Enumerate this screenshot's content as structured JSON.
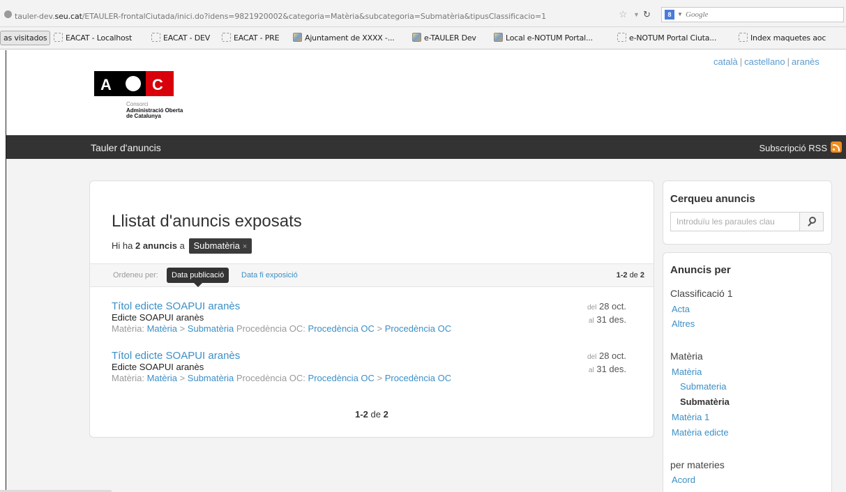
{
  "browser": {
    "url_prefix": "tauler-dev.",
    "url_host": "seu.cat",
    "url_rest": "/ETAULER-frontalCiutada/inici.do?idens=9821920002&categoria=Matèria&subcategoria=Submatèria&tipusClassificacio=1",
    "search_engine_placeholder": "Google",
    "bookmarks": [
      "as visitados",
      "EACAT - Localhost",
      "EACAT - DEV",
      "EACAT - PRE",
      "Ajuntament de XXXX -...",
      "e-TAULER Dev",
      "Local e-NOTUM Portal...",
      "e-NOTUM Portal Ciuta...",
      "Index maquetes aoc"
    ]
  },
  "languages": [
    "català",
    "castellano",
    "aranès"
  ],
  "logo": {
    "letters": [
      "A",
      "C"
    ],
    "line1": "Consorci",
    "line2": "Administració Oberta",
    "line3": "de Catalunya"
  },
  "nav": {
    "title": "Tauler d'anuncis",
    "rss_label": "Subscripció RSS"
  },
  "main": {
    "title": "Llistat d'anuncis exposats",
    "count_prefix": "Hi ha",
    "count_value": "2 anuncis",
    "count_mid": "a",
    "filter_tag": "Submatèria",
    "filter_close": "×",
    "sort_label": "Ordeneu per:",
    "sort_active": "Data publicació",
    "sort_other": "Data fi exposició",
    "range": "1-2",
    "range_de": "de",
    "range_total": "2"
  },
  "results": [
    {
      "title": "Títol edicte SOAPUI aranès",
      "desc": "Edicte SOAPUI aranès",
      "meta_label1": "Matèria:",
      "link1": "Matèria",
      "arrow1": ">",
      "link2": "Submatèria",
      "meta_label2": "Procedència OC:",
      "link3": "Procedència OC",
      "arrow2": ">",
      "link4": "Procedència OC",
      "from_pre": "del",
      "from_date": "28 oct.",
      "to_pre": "al",
      "to_date": "31 des."
    },
    {
      "title": "Títol edicte SOAPUI aranès",
      "desc": "Edicte SOAPUI aranès",
      "meta_label1": "Matèria:",
      "link1": "Matèria",
      "arrow1": ">",
      "link2": "Submatèria",
      "meta_label2": "Procedència OC:",
      "link3": "Procedència OC",
      "arrow2": ">",
      "link4": "Procedència OC",
      "from_pre": "del",
      "from_date": "28 oct.",
      "to_pre": "al",
      "to_date": "31 des."
    }
  ],
  "pager": {
    "range": "1-2",
    "de": "de",
    "total": "2"
  },
  "sidebar": {
    "search_title": "Cerqueu anuncis",
    "search_placeholder": "Introduïu les paraules clau",
    "facets_title": "Anuncis per",
    "group1": "Classificació 1",
    "group1_links": [
      "Acta",
      "Altres"
    ],
    "group2": "Matèria",
    "group2_link": "Matèria",
    "group2_sub": "Submateria",
    "group2_current": "Submatèria",
    "group2_links": [
      "Matèria 1",
      "Matèria edicte"
    ],
    "group3": "per materies",
    "group3_links": [
      "Acord"
    ]
  },
  "colors": {
    "link": "#3b8fc7",
    "nav_bg": "#333333",
    "logo_red": "#d8000a",
    "rss": "#f28c1e"
  }
}
